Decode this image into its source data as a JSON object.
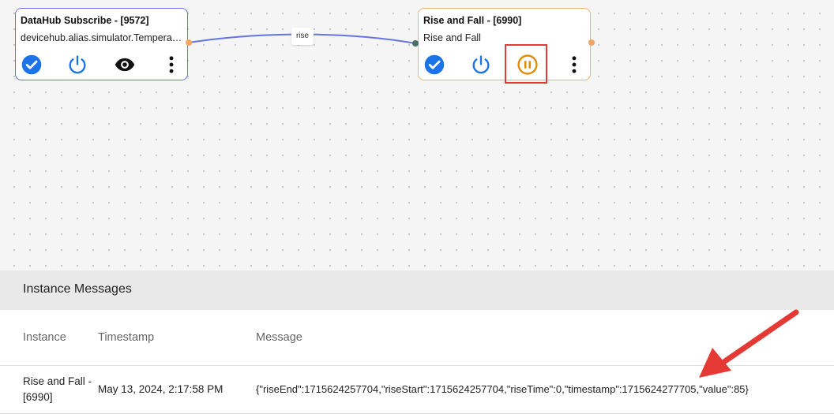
{
  "flow": {
    "edge_label": "rise",
    "nodes": [
      {
        "title": "DataHub Subscribe - [9572]",
        "subtitle": "devicehub.alias.simulator.TemperatureSensor",
        "actions": [
          "check-circle-icon",
          "power-icon",
          "eye-icon",
          "more-vert-icon"
        ]
      },
      {
        "title": "Rise and Fall - [6990]",
        "subtitle": "Rise and Fall",
        "actions": [
          "check-circle-icon",
          "power-icon",
          "pause-circle-icon",
          "more-vert-icon"
        ]
      }
    ]
  },
  "messages": {
    "title": "Instance Messages",
    "columns": [
      "Instance",
      "Timestamp",
      "Message"
    ],
    "rows": [
      {
        "instance": "Rise and Fall - [6990]",
        "timestamp": "May 13, 2024, 2:17:58 PM",
        "message": "{\"riseEnd\":1715624257704,\"riseStart\":1715624257704,\"riseTime\":0,\"timestamp\":1715624277705,\"value\":85}"
      }
    ]
  },
  "colors": {
    "blue_icon": "#1a73e8",
    "pause_orange": "#e08a00",
    "highlight_red": "#e03a3a",
    "edge": "#6673e6",
    "node_a_border": "#6673e6",
    "node_b_border": "#f0b36b"
  }
}
